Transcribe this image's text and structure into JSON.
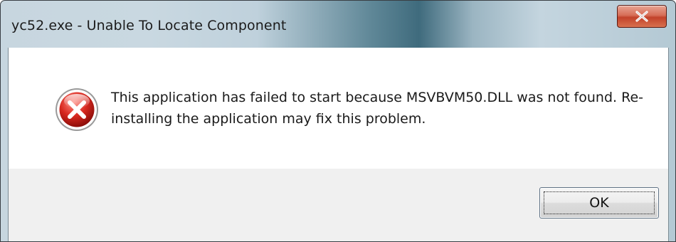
{
  "window": {
    "title": "yc52.exe - Unable To Locate Component",
    "close_symbol": "x"
  },
  "dialog": {
    "icon": "error-icon",
    "message": "This application has failed to start because MSVBVM50.DLL was not found. Re-installing the application may fix this problem.",
    "ok_label": "OK"
  },
  "colors": {
    "close_button": "#c2422a",
    "error_icon": "#c81e1e",
    "button_area": "#f0f0f0"
  }
}
